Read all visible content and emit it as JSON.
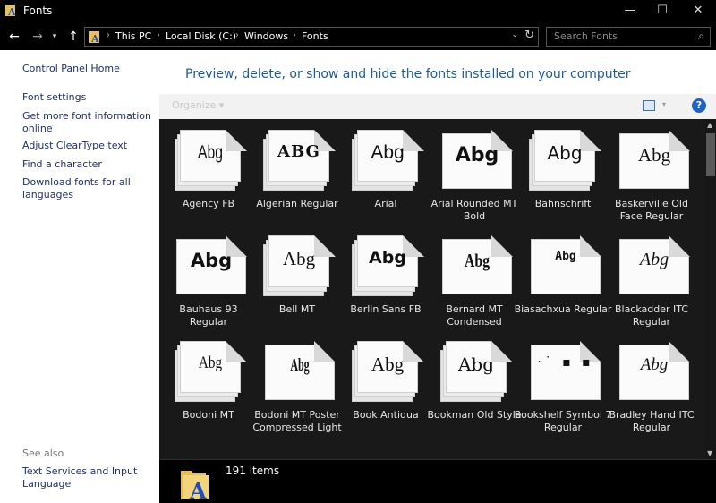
{
  "window": {
    "title": "Fonts",
    "minimize": "—",
    "maximize": "☐",
    "close": "✕"
  },
  "nav": {
    "back": "←",
    "forward": "→",
    "recent": "▾",
    "up": "↑",
    "breadcrumbs": [
      "This PC",
      "Local Disk (C:)",
      "Windows",
      "Fonts"
    ],
    "separator": "›",
    "dropdown": "⌄",
    "refresh": "↻",
    "search_placeholder": "Search Fonts",
    "search_icon": "⌕"
  },
  "left_pane": {
    "home": "Control Panel Home",
    "links": [
      "Font settings",
      "Get more font information online",
      "Adjust ClearType text",
      "Find a character",
      "Download fonts for all languages"
    ],
    "see_also_title": "See also",
    "see_also_links": [
      "Text Services and Input Language"
    ]
  },
  "header": {
    "headline": "Preview, delete, or show and hide the fonts installed on your computer",
    "organize": "Organize  ▾",
    "view_dropdown": "▾",
    "help": "?"
  },
  "fonts": [
    {
      "name": "Agency FB",
      "sample": "Abg",
      "icon": "font-family-icon"
    },
    {
      "name": "Algerian Regular",
      "sample": "ABG",
      "icon": "font-family-icon"
    },
    {
      "name": "Arial",
      "sample": "Abg",
      "icon": "font-family-icon"
    },
    {
      "name": "Arial Rounded MT Bold",
      "sample": "Abg",
      "icon": "font-file-icon"
    },
    {
      "name": "Bahnschrift",
      "sample": "Abg",
      "icon": "font-family-icon"
    },
    {
      "name": "Baskerville Old Face Regular",
      "sample": "Abg",
      "icon": "font-file-icon"
    },
    {
      "name": "Bauhaus 93 Regular",
      "sample": "Abg",
      "icon": "font-file-icon"
    },
    {
      "name": "Bell MT",
      "sample": "Abg",
      "icon": "font-family-icon"
    },
    {
      "name": "Berlin Sans FB",
      "sample": "Abg",
      "icon": "font-family-icon"
    },
    {
      "name": "Bernard MT Condensed",
      "sample": "Abg",
      "icon": "font-file-icon"
    },
    {
      "name": "Biasachxua Regular",
      "sample": "Abg",
      "icon": "font-file-icon"
    },
    {
      "name": "Blackadder ITC Regular",
      "sample": "Abg",
      "icon": "font-file-icon"
    },
    {
      "name": "Bodoni MT",
      "sample": "Abg",
      "icon": "font-family-icon"
    },
    {
      "name": "Bodoni MT Poster Compressed Light",
      "sample": "Abg",
      "icon": "font-file-icon"
    },
    {
      "name": "Book Antiqua",
      "sample": "Abg",
      "icon": "font-family-icon"
    },
    {
      "name": "Bookman Old Style",
      "sample": "Abg",
      "icon": "font-family-icon"
    },
    {
      "name": "Bookshelf Symbol 7 Regular",
      "sample": "·˙ ▪ ▪",
      "icon": "font-file-icon"
    },
    {
      "name": "Bradley Hand ITC Regular",
      "sample": "Abg",
      "icon": "font-file-icon"
    }
  ],
  "status": {
    "item_count": "191 items"
  }
}
